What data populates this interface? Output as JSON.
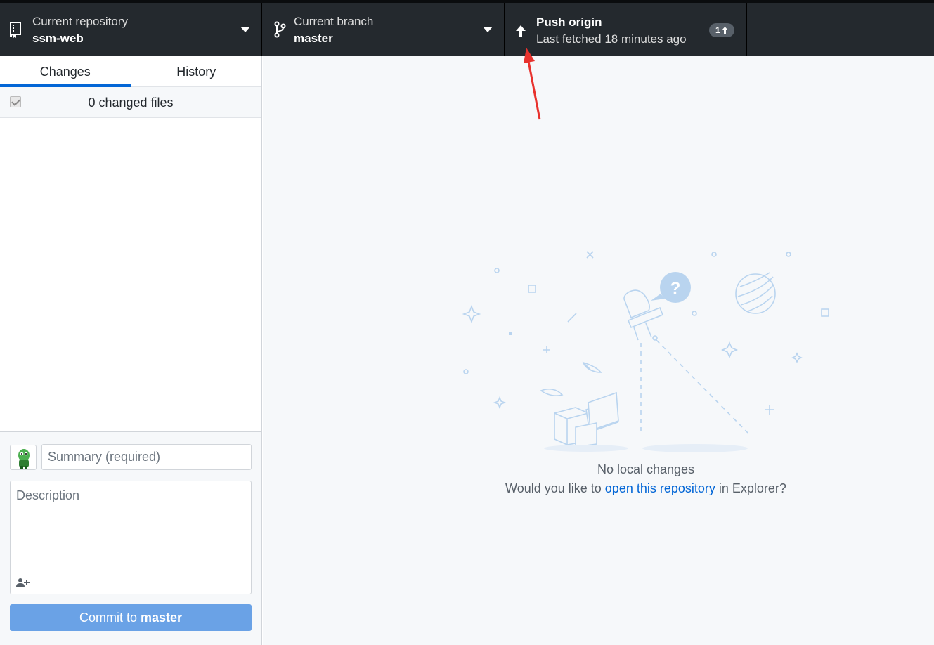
{
  "toolbar": {
    "repository": {
      "label": "Current repository",
      "value": "ssm-web",
      "icon": "repo-icon"
    },
    "branch": {
      "label": "Current branch",
      "value": "master",
      "icon": "git-branch-icon"
    },
    "push": {
      "label": "Push origin",
      "status": "Last fetched 18 minutes ago",
      "icon": "arrow-up-icon",
      "ahead_count": "1"
    }
  },
  "sidebar": {
    "tabs": [
      {
        "label": "Changes",
        "selected": true
      },
      {
        "label": "History",
        "selected": false
      }
    ],
    "changes_count": "0 changed files",
    "commit": {
      "summary_placeholder": "Summary (required)",
      "description_placeholder": "Description",
      "button_prefix": "Commit to ",
      "button_branch": "master"
    }
  },
  "main": {
    "title": "No local changes",
    "sub_before": "Would you like to ",
    "sub_link": "open this repository",
    "sub_after": " in Explorer?"
  },
  "colors": {
    "toolbar_bg": "#24292e",
    "accent": "#0366d6",
    "commit_button": "#6aa2e6",
    "annotation_arrow": "#e8322d"
  }
}
